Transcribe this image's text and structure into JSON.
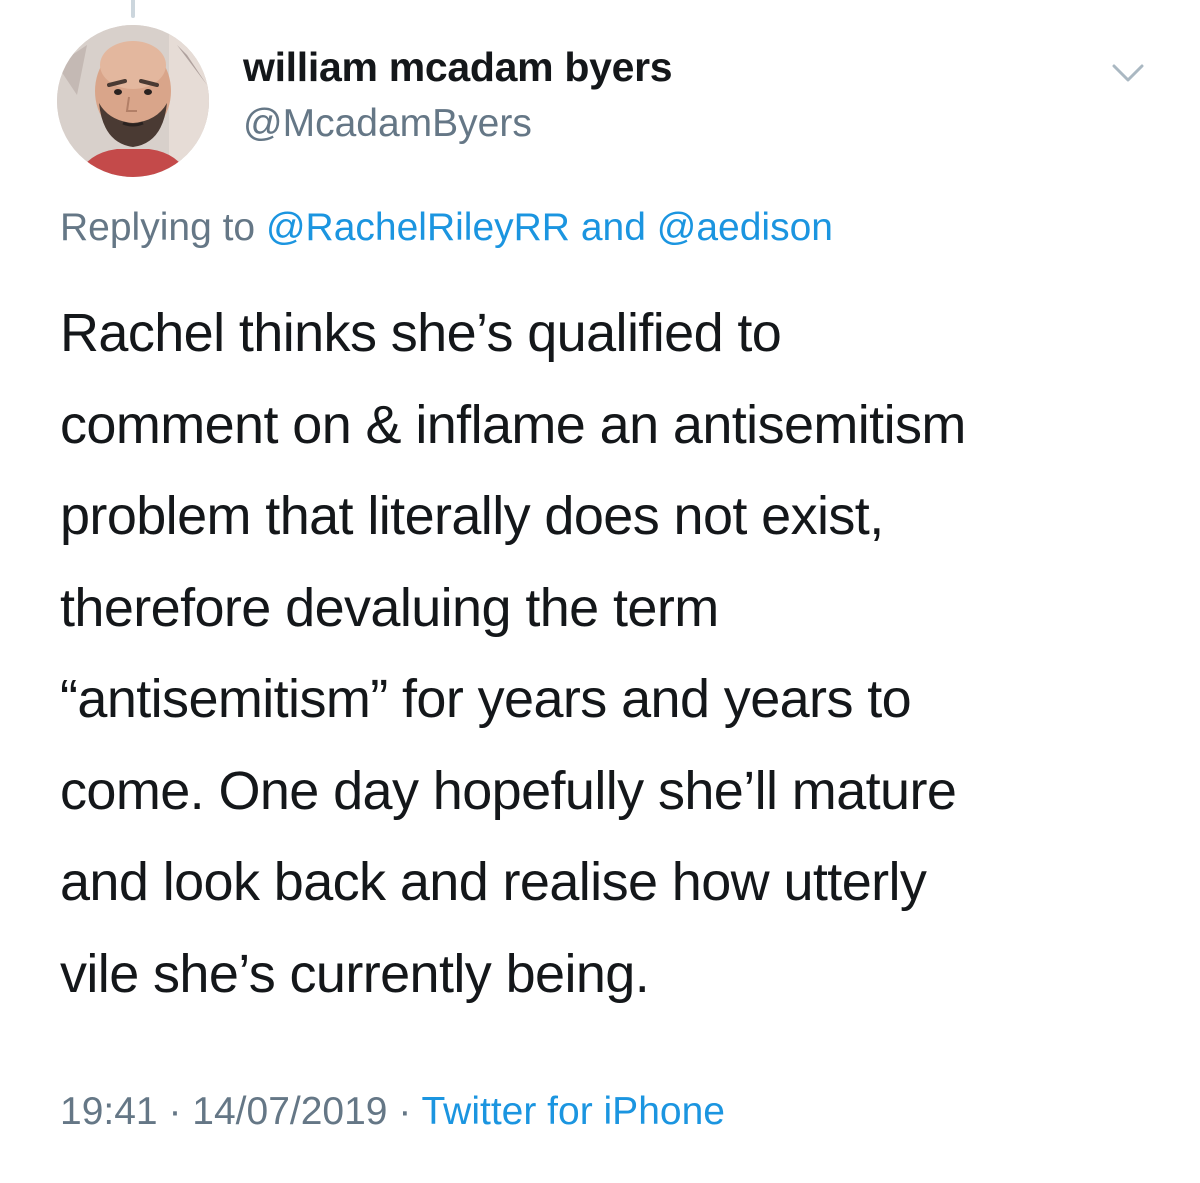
{
  "tweet": {
    "author": {
      "display_name": "william mcadam byers",
      "handle": "@McadamByers"
    },
    "reply": {
      "prefix": "Replying to",
      "mention_1": "@RachelRileyRR",
      "conjunction": "and",
      "mention_2": "@aedison"
    },
    "text_lines": [
      "Rachel thinks she’s qualified to",
      "comment on & inflame an antisemitism",
      "problem that literally does not exist,",
      "therefore devaluing the term",
      "“antisemitism” for years and years to",
      "come. One day hopefully she’ll mature",
      "and look back and realise how utterly",
      "vile she’s currently being."
    ],
    "meta": {
      "time": "19:41",
      "separator": "·",
      "date": "14/07/2019",
      "source": "Twitter for iPhone"
    }
  },
  "icons": {
    "more_options": "chevron-down-icon"
  },
  "colors": {
    "text_primary": "#14171a",
    "text_secondary": "#657786",
    "link": "#1b95e0",
    "thread_line": "#ccd6dd"
  }
}
